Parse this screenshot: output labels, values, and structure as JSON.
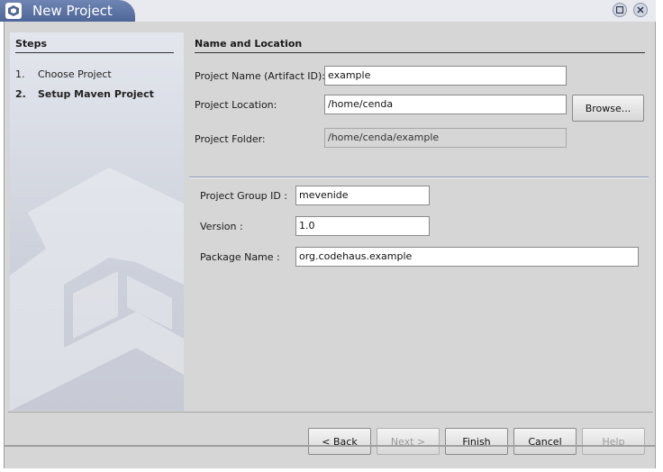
{
  "window": {
    "title": "New Project"
  },
  "steps": {
    "title": "Steps",
    "items": [
      {
        "num": "1.",
        "label": "Choose Project"
      },
      {
        "num": "2.",
        "label": "Setup Maven Project"
      }
    ]
  },
  "section": {
    "title": "Name and Location",
    "project_name_label": "Project Name (Artifact ID):",
    "project_name_value": "example",
    "project_location_label": "Project Location:",
    "project_location_value": "/home/cenda",
    "browse_label": "Browse...",
    "project_folder_label": "Project Folder:",
    "project_folder_value": "/home/cenda/example",
    "group_id_label": "Project Group ID :",
    "group_id_value": "mevenide",
    "version_label": "Version :",
    "version_value": "1.0",
    "package_label": "Package Name :",
    "package_value": "org.codehaus.example"
  },
  "footer": {
    "back": "< Back",
    "next": "Next >",
    "finish": "Finish",
    "cancel": "Cancel",
    "help": "Help"
  },
  "colors": {
    "title_accent": "#5a72a6",
    "dialog_bg": "#d6d6d6"
  }
}
